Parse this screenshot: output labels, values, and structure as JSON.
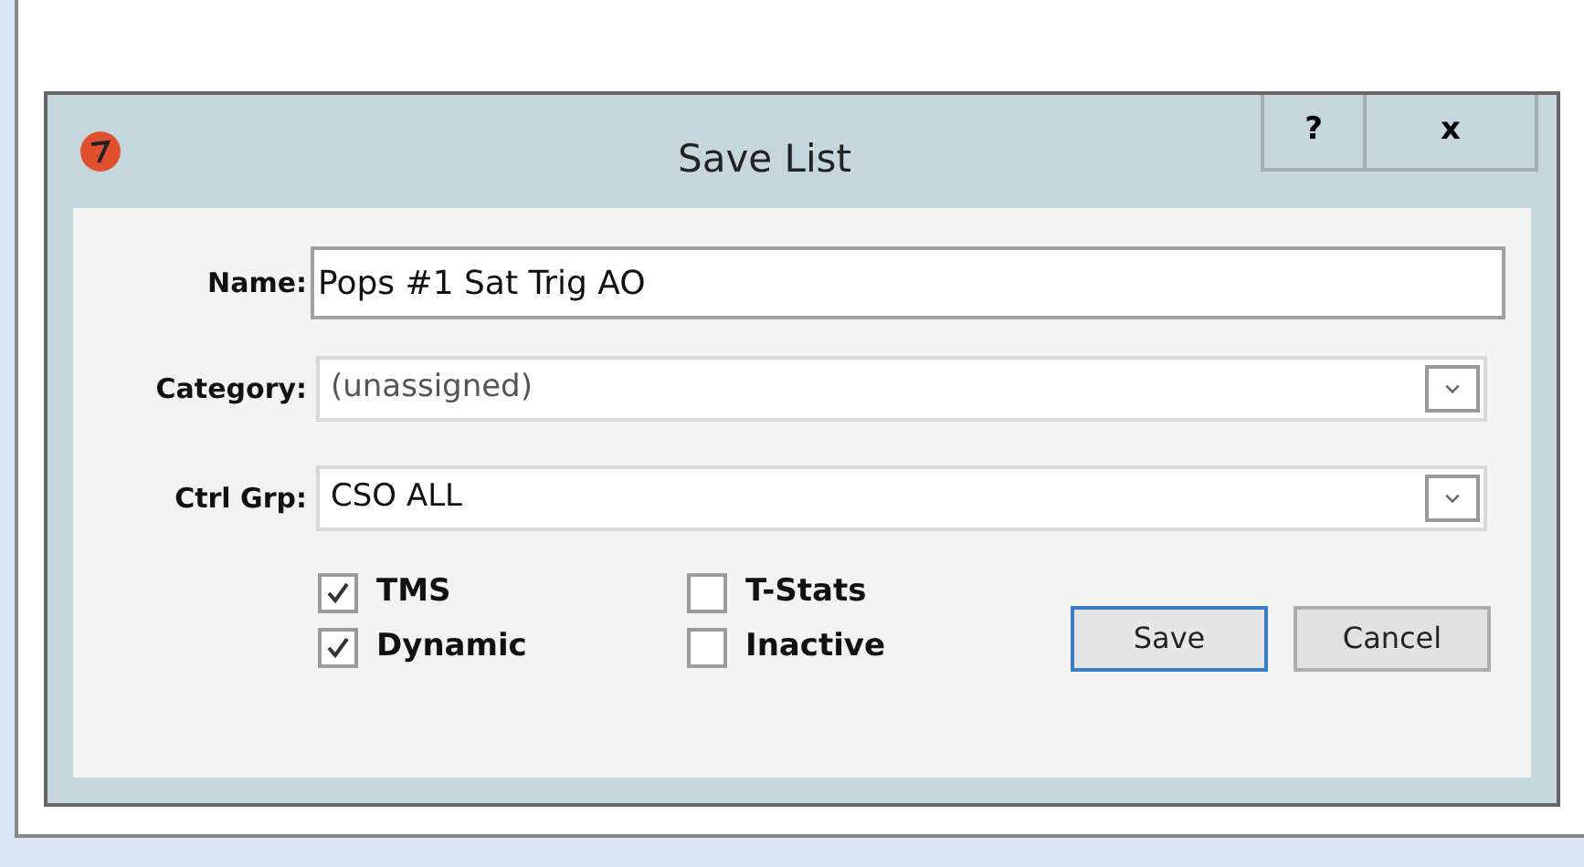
{
  "window": {
    "title": "Save List",
    "help": "?",
    "close": "x"
  },
  "fields": [
    {
      "kind": "text",
      "label": "Name:",
      "value": "Pops #1 Sat Trig AO"
    },
    {
      "kind": "dropdown",
      "label": "Category:",
      "value": "(unassigned)",
      "disabled": true
    },
    {
      "kind": "dropdown",
      "label": "Ctrl Grp:",
      "value": "CSO ALL",
      "disabled": false
    }
  ],
  "checkboxes": [
    {
      "label": "TMS",
      "checked": true
    },
    {
      "label": "T-Stats",
      "checked": false
    },
    {
      "label": "Dynamic",
      "checked": true
    },
    {
      "label": "Inactive",
      "checked": false
    }
  ],
  "buttons": [
    {
      "label": "Save",
      "selected": true
    },
    {
      "label": "Cancel",
      "selected": false
    }
  ]
}
